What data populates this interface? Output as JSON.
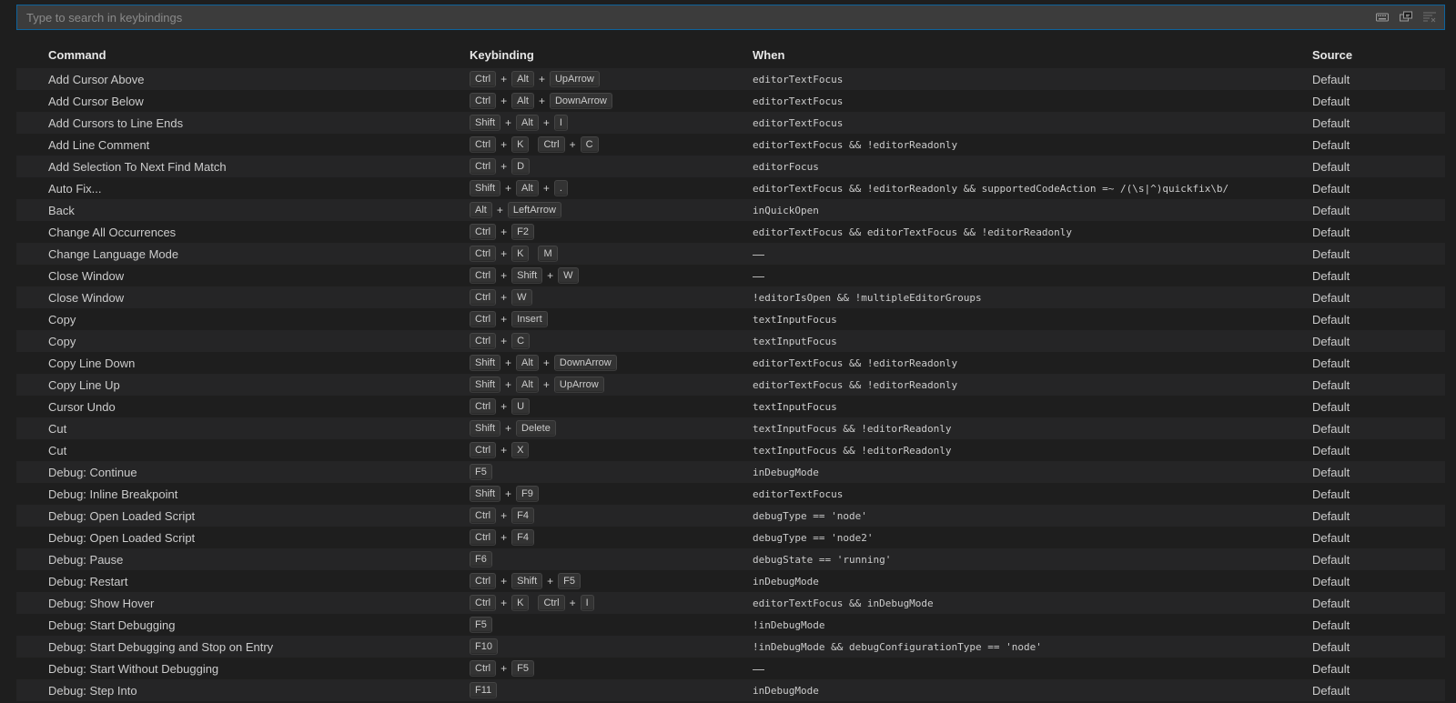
{
  "search": {
    "placeholder": "Type to search in keybindings",
    "value": ""
  },
  "search_actions": [
    {
      "icon": "keyboard-icon"
    },
    {
      "icon": "sort-by-precedence-icon"
    },
    {
      "icon": "clear-filter-icon"
    }
  ],
  "headers": {
    "command": "Command",
    "keybinding": "Keybinding",
    "when": "When",
    "source": "Source"
  },
  "rows": [
    {
      "command": "Add Cursor Above",
      "keys": [
        [
          "Ctrl",
          "Alt",
          "UpArrow"
        ]
      ],
      "when": "editorTextFocus",
      "source": "Default"
    },
    {
      "command": "Add Cursor Below",
      "keys": [
        [
          "Ctrl",
          "Alt",
          "DownArrow"
        ]
      ],
      "when": "editorTextFocus",
      "source": "Default"
    },
    {
      "command": "Add Cursors to Line Ends",
      "keys": [
        [
          "Shift",
          "Alt",
          "I"
        ]
      ],
      "when": "editorTextFocus",
      "source": "Default"
    },
    {
      "command": "Add Line Comment",
      "keys": [
        [
          "Ctrl",
          "K"
        ],
        [
          "Ctrl",
          "C"
        ]
      ],
      "when": "editorTextFocus && !editorReadonly",
      "source": "Default"
    },
    {
      "command": "Add Selection To Next Find Match",
      "keys": [
        [
          "Ctrl",
          "D"
        ]
      ],
      "when": "editorFocus",
      "source": "Default"
    },
    {
      "command": "Auto Fix...",
      "keys": [
        [
          "Shift",
          "Alt",
          "."
        ]
      ],
      "when": "editorTextFocus && !editorReadonly && supportedCodeAction =~ /(\\s|^)quickfix\\b/",
      "source": "Default"
    },
    {
      "command": "Back",
      "keys": [
        [
          "Alt",
          "LeftArrow"
        ]
      ],
      "when": "inQuickOpen",
      "source": "Default"
    },
    {
      "command": "Change All Occurrences",
      "keys": [
        [
          "Ctrl",
          "F2"
        ]
      ],
      "when": "editorTextFocus && editorTextFocus && !editorReadonly",
      "source": "Default"
    },
    {
      "command": "Change Language Mode",
      "keys": [
        [
          "Ctrl",
          "K"
        ],
        [
          "M"
        ]
      ],
      "when": "—",
      "source": "Default"
    },
    {
      "command": "Close Window",
      "keys": [
        [
          "Ctrl",
          "Shift",
          "W"
        ]
      ],
      "when": "—",
      "source": "Default"
    },
    {
      "command": "Close Window",
      "keys": [
        [
          "Ctrl",
          "W"
        ]
      ],
      "when": "!editorIsOpen && !multipleEditorGroups",
      "source": "Default"
    },
    {
      "command": "Copy",
      "keys": [
        [
          "Ctrl",
          "Insert"
        ]
      ],
      "when": "textInputFocus",
      "source": "Default"
    },
    {
      "command": "Copy",
      "keys": [
        [
          "Ctrl",
          "C"
        ]
      ],
      "when": "textInputFocus",
      "source": "Default"
    },
    {
      "command": "Copy Line Down",
      "keys": [
        [
          "Shift",
          "Alt",
          "DownArrow"
        ]
      ],
      "when": "editorTextFocus && !editorReadonly",
      "source": "Default"
    },
    {
      "command": "Copy Line Up",
      "keys": [
        [
          "Shift",
          "Alt",
          "UpArrow"
        ]
      ],
      "when": "editorTextFocus && !editorReadonly",
      "source": "Default"
    },
    {
      "command": "Cursor Undo",
      "keys": [
        [
          "Ctrl",
          "U"
        ]
      ],
      "when": "textInputFocus",
      "source": "Default"
    },
    {
      "command": "Cut",
      "keys": [
        [
          "Shift",
          "Delete"
        ]
      ],
      "when": "textInputFocus && !editorReadonly",
      "source": "Default"
    },
    {
      "command": "Cut",
      "keys": [
        [
          "Ctrl",
          "X"
        ]
      ],
      "when": "textInputFocus && !editorReadonly",
      "source": "Default"
    },
    {
      "command": "Debug: Continue",
      "keys": [
        [
          "F5"
        ]
      ],
      "when": "inDebugMode",
      "source": "Default"
    },
    {
      "command": "Debug: Inline Breakpoint",
      "keys": [
        [
          "Shift",
          "F9"
        ]
      ],
      "when": "editorTextFocus",
      "source": "Default"
    },
    {
      "command": "Debug: Open Loaded Script",
      "keys": [
        [
          "Ctrl",
          "F4"
        ]
      ],
      "when": "debugType == 'node'",
      "source": "Default"
    },
    {
      "command": "Debug: Open Loaded Script",
      "keys": [
        [
          "Ctrl",
          "F4"
        ]
      ],
      "when": "debugType == 'node2'",
      "source": "Default"
    },
    {
      "command": "Debug: Pause",
      "keys": [
        [
          "F6"
        ]
      ],
      "when": "debugState == 'running'",
      "source": "Default"
    },
    {
      "command": "Debug: Restart",
      "keys": [
        [
          "Ctrl",
          "Shift",
          "F5"
        ]
      ],
      "when": "inDebugMode",
      "source": "Default"
    },
    {
      "command": "Debug: Show Hover",
      "keys": [
        [
          "Ctrl",
          "K"
        ],
        [
          "Ctrl",
          "I"
        ]
      ],
      "when": "editorTextFocus && inDebugMode",
      "source": "Default"
    },
    {
      "command": "Debug: Start Debugging",
      "keys": [
        [
          "F5"
        ]
      ],
      "when": "!inDebugMode",
      "source": "Default"
    },
    {
      "command": "Debug: Start Debugging and Stop on Entry",
      "keys": [
        [
          "F10"
        ]
      ],
      "when": "!inDebugMode && debugConfigurationType == 'node'",
      "source": "Default"
    },
    {
      "command": "Debug: Start Without Debugging",
      "keys": [
        [
          "Ctrl",
          "F5"
        ]
      ],
      "when": "—",
      "source": "Default"
    },
    {
      "command": "Debug: Step Into",
      "keys": [
        [
          "F11"
        ]
      ],
      "when": "inDebugMode",
      "source": "Default"
    }
  ]
}
